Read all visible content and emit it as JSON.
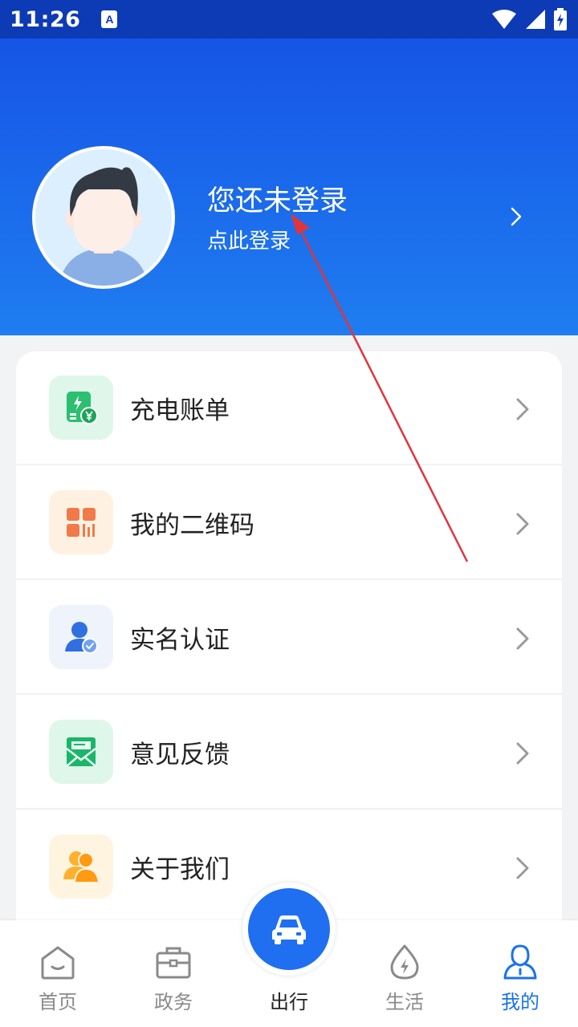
{
  "status_bar": {
    "time": "11:26",
    "notification_icon_text": "A",
    "icons": [
      "wifi-icon",
      "signal-icon",
      "battery-icon"
    ]
  },
  "header": {
    "title": "您还未登录",
    "subtitle": "点此登录",
    "colors": {
      "top": "#1655e6",
      "bottom": "#1f7df0"
    }
  },
  "menu": {
    "items": [
      {
        "label": "充电账单",
        "icon": "charging-bill-icon",
        "bg": "#dff7ea"
      },
      {
        "label": "我的二维码",
        "icon": "qrcode-icon",
        "bg": "#fff1e2"
      },
      {
        "label": "实名认证",
        "icon": "verified-user-icon",
        "bg": "#eef3fc"
      },
      {
        "label": "意见反馈",
        "icon": "feedback-mail-icon",
        "bg": "#dff7ea"
      },
      {
        "label": "关于我们",
        "icon": "about-us-icon",
        "bg": "#fff4e0"
      }
    ]
  },
  "bottom_nav": {
    "items": [
      {
        "label": "首页",
        "icon": "home-icon"
      },
      {
        "label": "政务",
        "icon": "briefcase-icon"
      },
      {
        "label": "出行",
        "icon": "car-icon"
      },
      {
        "label": "生活",
        "icon": "water-drop-icon"
      },
      {
        "label": "我的",
        "icon": "user-icon"
      }
    ],
    "active_index": 4,
    "active_color": "#1a73e8",
    "inactive_color": "#8a8a8a"
  }
}
